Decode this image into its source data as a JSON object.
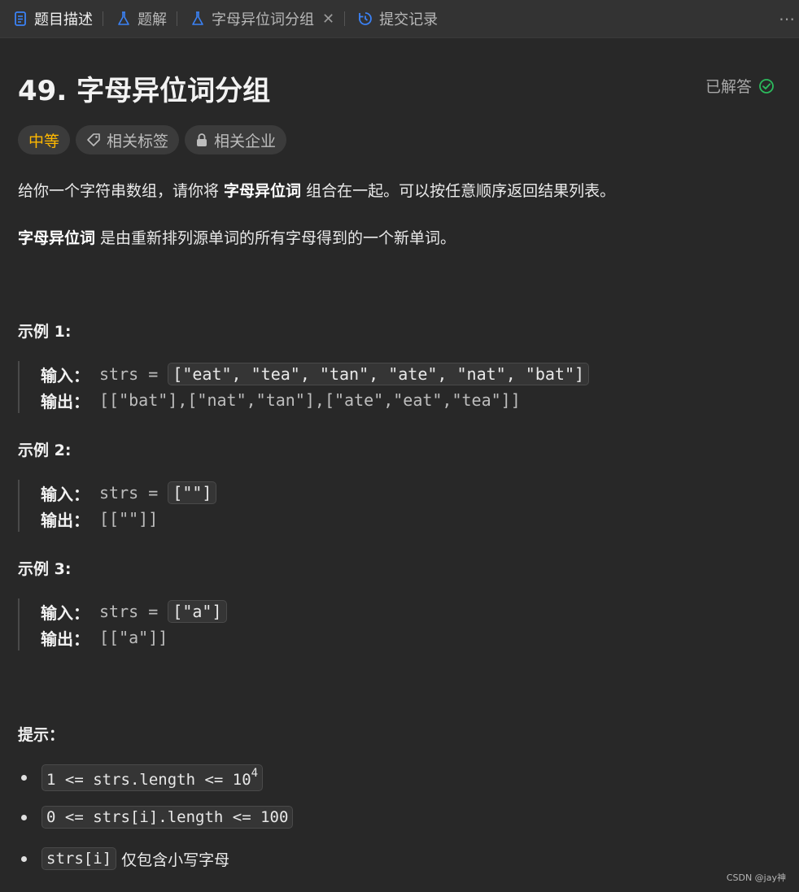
{
  "tabs": [
    {
      "label": "题目描述",
      "icon": "doc-icon",
      "active": true
    },
    {
      "label": "题解",
      "icon": "flask-icon"
    },
    {
      "label": "字母异位词分组",
      "icon": "flask-icon",
      "closable": true
    },
    {
      "label": "提交记录",
      "icon": "history-icon"
    }
  ],
  "problem": {
    "title": "49. 字母异位词分组",
    "status": "已解答",
    "difficulty": "中等",
    "tag_related": "相关标签",
    "tag_company": "相关企业"
  },
  "description": {
    "p1_pre": "给你一个字符串数组，请你将 ",
    "p1_bold": "字母异位词",
    "p1_post": " 组合在一起。可以按任意顺序返回结果列表。",
    "p2_bold": "字母异位词",
    "p2_post": " 是由重新排列源单词的所有字母得到的一个新单词。"
  },
  "examples": [
    {
      "heading": "示例 1:",
      "in_label": "输入：",
      "in_prefix": "strs = ",
      "in_code": "[\"eat\", \"tea\", \"tan\", \"ate\", \"nat\", \"bat\"]",
      "out_label": "输出：",
      "out": "[[\"bat\"],[\"nat\",\"tan\"],[\"ate\",\"eat\",\"tea\"]]"
    },
    {
      "heading": "示例 2:",
      "in_label": "输入：",
      "in_prefix": "strs = ",
      "in_code": "[\"\"]",
      "out_label": "输出：",
      "out": "[[\"\"]]"
    },
    {
      "heading": "示例 3:",
      "in_label": "输入：",
      "in_prefix": "strs = ",
      "in_code": "[\"a\"]",
      "out_label": "输出：",
      "out": "[[\"a\"]]"
    }
  ],
  "hints": {
    "heading": "提示：",
    "h1_code": "1 <= strs.length <= 10",
    "h1_sup": "4",
    "h2_code": "0 <= strs[i].length <= 100",
    "h3_code": "strs[i]",
    "h3_text": "仅包含小写字母"
  },
  "watermark": "CSDN @jay神",
  "colors": {
    "accent": "#3b82f6",
    "difficulty": "#ffb800",
    "solved": "#2cbb5d"
  }
}
